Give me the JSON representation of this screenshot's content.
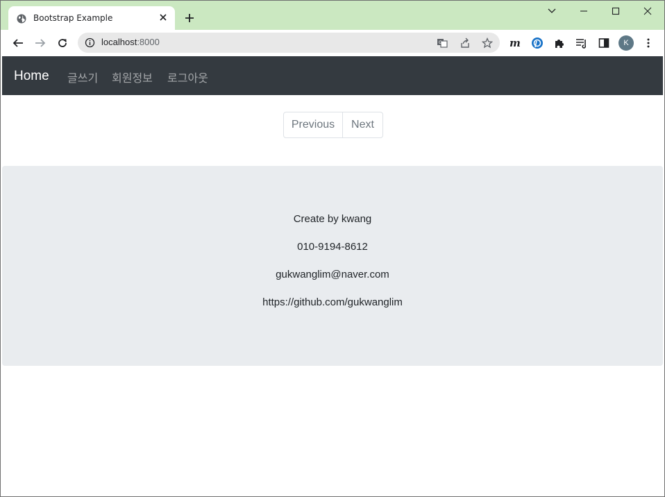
{
  "browser": {
    "tab_title": "Bootstrap Example",
    "url_host": "localhost",
    "url_port": ":8000",
    "profile_initial": "K",
    "colors": {
      "tabstrip": "#cbe8c1",
      "avatar": "#5e7886"
    }
  },
  "navbar": {
    "brand": "Home",
    "links": [
      "글쓰기",
      "회원정보",
      "로그아웃"
    ],
    "background": "#343a40"
  },
  "pagination": {
    "previous": "Previous",
    "next": "Next"
  },
  "footer": {
    "lines": [
      "Create by kwang",
      "010-9194-8612",
      "gukwanglim@naver.com",
      "https://github.com/gukwanglim"
    ],
    "background": "#e9ecef"
  }
}
